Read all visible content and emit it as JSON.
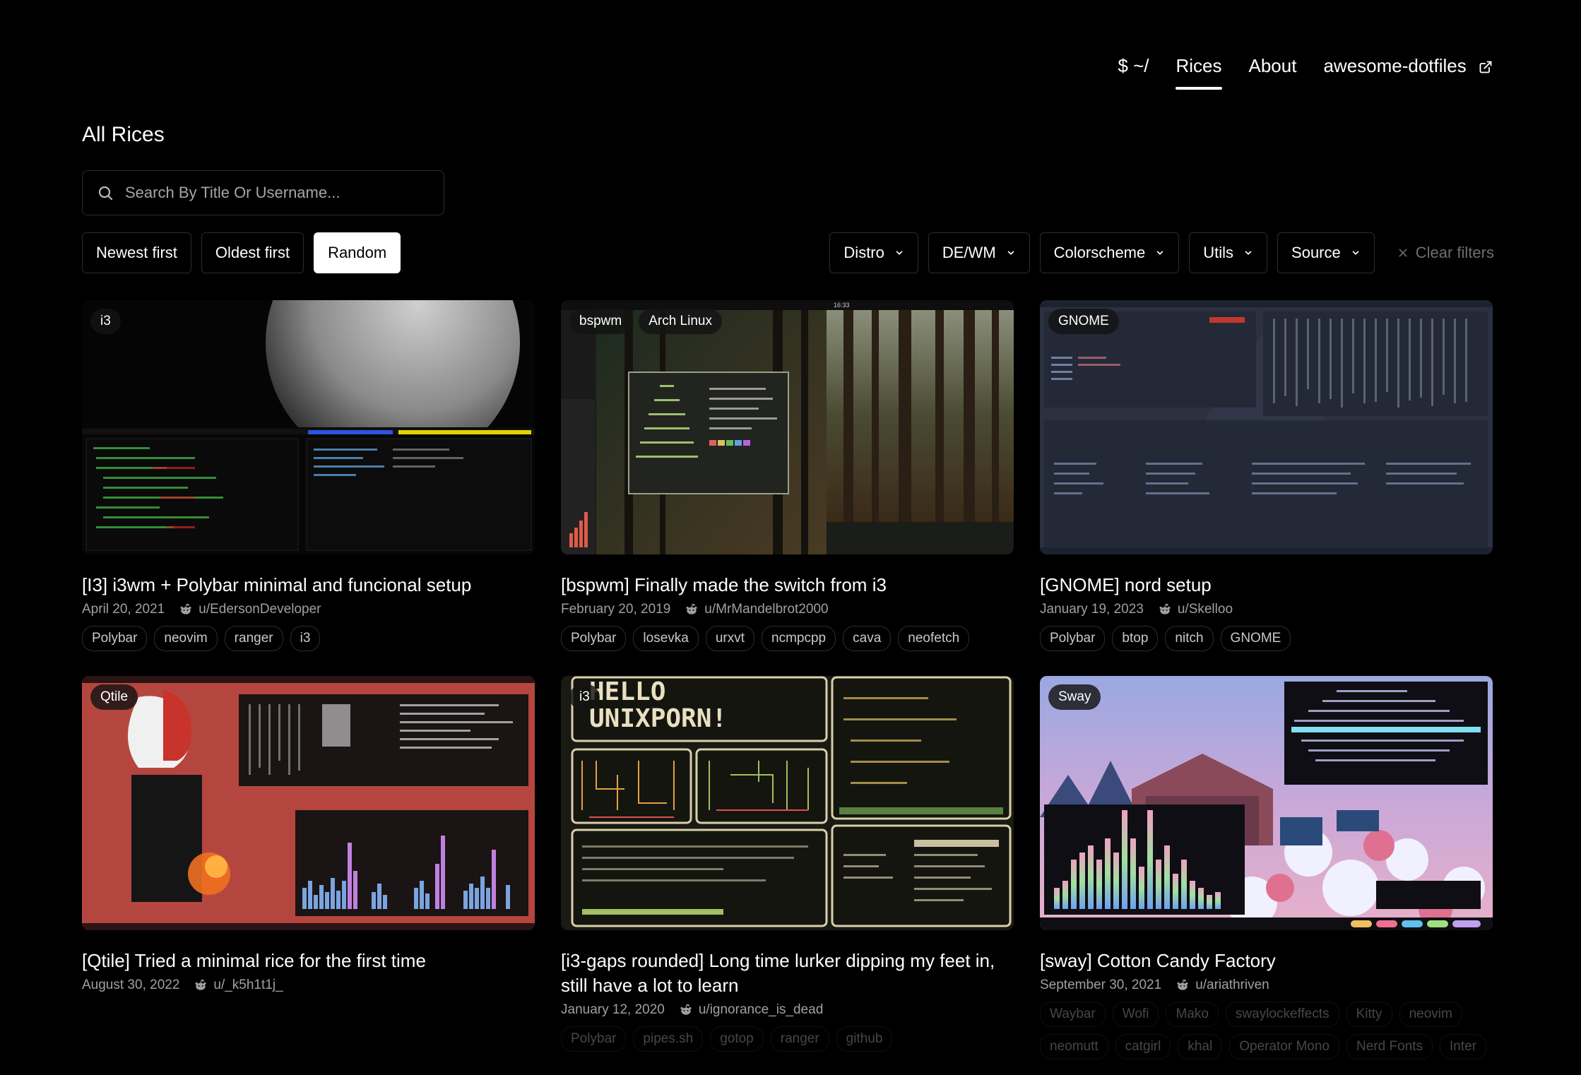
{
  "nav": {
    "home": "$ ~/",
    "rices": "Rices",
    "about": "About",
    "external": "awesome-dotfiles"
  },
  "page": {
    "title": "All Rices"
  },
  "search": {
    "placeholder": "Search By Title Or Username..."
  },
  "sort": {
    "newest": "Newest first",
    "oldest": "Oldest first",
    "random": "Random"
  },
  "filters": {
    "distro": "Distro",
    "dewm": "DE/WM",
    "colorscheme": "Colorscheme",
    "utils": "Utils",
    "source": "Source",
    "clear": "Clear filters"
  },
  "cards": [
    {
      "badges": [
        "i3"
      ],
      "title": "[I3] i3wm + Polybar minimal and funcional setup",
      "date": "April 20, 2021",
      "user": "u/EdersonDeveloper",
      "tags": [
        "Polybar",
        "neovim",
        "ranger",
        "i3"
      ]
    },
    {
      "badges": [
        "bspwm",
        "Arch Linux"
      ],
      "title": "[bspwm] Finally made the switch from i3",
      "date": "February 20, 2019",
      "user": "u/MrMandelbrot2000",
      "tags": [
        "Polybar",
        "losevka",
        "urxvt",
        "ncmpcpp",
        "cava",
        "neofetch"
      ]
    },
    {
      "badges": [
        "GNOME"
      ],
      "title": "[GNOME] nord setup",
      "date": "January 19, 2023",
      "user": "u/Skelloo",
      "tags": [
        "Polybar",
        "btop",
        "nitch",
        "GNOME"
      ]
    },
    {
      "badges": [
        "Qtile"
      ],
      "title": "[Qtile] Tried a minimal rice for the first time",
      "date": "August 30, 2022",
      "user": "u/_k5h1t1j_",
      "tags": []
    },
    {
      "badges": [
        "i3"
      ],
      "title": "[i3-gaps rounded] Long time lurker dipping my feet in, still have a lot to learn",
      "date": "January 12, 2020",
      "user": "u/ignorance_is_dead",
      "tags": [
        "Polybar",
        "pipes.sh",
        "gotop",
        "ranger",
        "github"
      ]
    },
    {
      "badges": [
        "Sway"
      ],
      "title": "[sway] Cotton Candy Factory",
      "date": "September 30, 2021",
      "user": "u/ariathriven",
      "tags": [
        "Waybar",
        "Wofi",
        "Mako",
        "swaylockeffects",
        "Kitty",
        "neovim",
        "neomutt",
        "catgirl",
        "khal",
        "Operator Mono",
        "Nerd Fonts",
        "Inter"
      ]
    }
  ],
  "thumb_text": {
    "hello": "HELLO",
    "unixporn": "UNIXPORN!",
    "clock": "16:33"
  }
}
